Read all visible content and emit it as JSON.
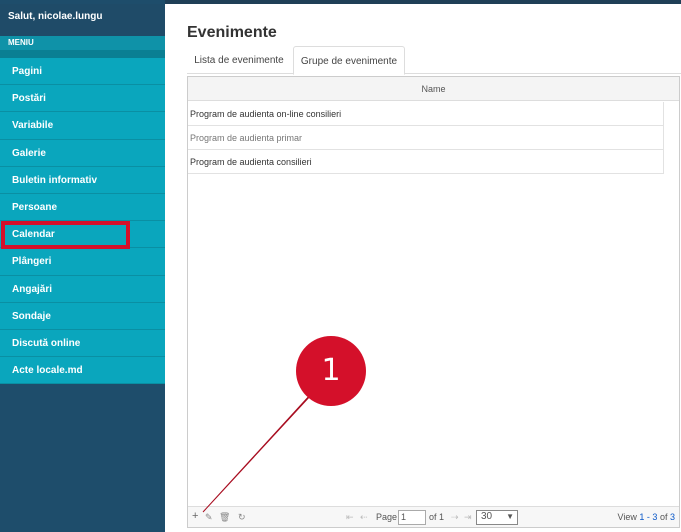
{
  "sidebar": {
    "greeting": "Salut, nicolae.lungu",
    "menu_title": "MENIU",
    "items": [
      {
        "label": "Pagini"
      },
      {
        "label": "Postări"
      },
      {
        "label": "Variabile"
      },
      {
        "label": "Galerie"
      },
      {
        "label": "Buletin informativ"
      },
      {
        "label": "Persoane"
      },
      {
        "label": "Calendar"
      },
      {
        "label": "Plângeri"
      },
      {
        "label": "Angajări"
      },
      {
        "label": "Sondaje"
      },
      {
        "label": "Discută online"
      },
      {
        "label": "Acte locale.md"
      }
    ],
    "highlighted_item": "Calendar"
  },
  "main": {
    "title": "Evenimente",
    "tabs": [
      {
        "label": "Lista de evenimente",
        "active": false
      },
      {
        "label": "Grupe de evenimente",
        "active": true
      }
    ],
    "grid": {
      "column_header": "Name",
      "rows": [
        {
          "name": "Program de audienta on-line consilieri"
        },
        {
          "name": "Program de audienta primar"
        },
        {
          "name": "Program de audienta consilieri"
        }
      ]
    },
    "pager": {
      "icons": [
        "plus-icon",
        "edit-icon",
        "trash-icon",
        "refresh-icon",
        "first-page-icon",
        "prev-page-icon",
        "next-page-icon",
        "last-page-icon"
      ],
      "page_label": "Page",
      "page_value": "1",
      "of_label": "of 1",
      "rows_per_page": "30",
      "view_prefix": "View",
      "view_range": "1 - 3",
      "view_of": "of",
      "view_total": "3"
    }
  },
  "annotation": {
    "badge_number": "1",
    "color": "#d4102a"
  },
  "colors": {
    "sidebar_bg": "#1e4d6b",
    "menu_item_bg": "#0aa6bd",
    "accent_red": "#d4102a"
  }
}
